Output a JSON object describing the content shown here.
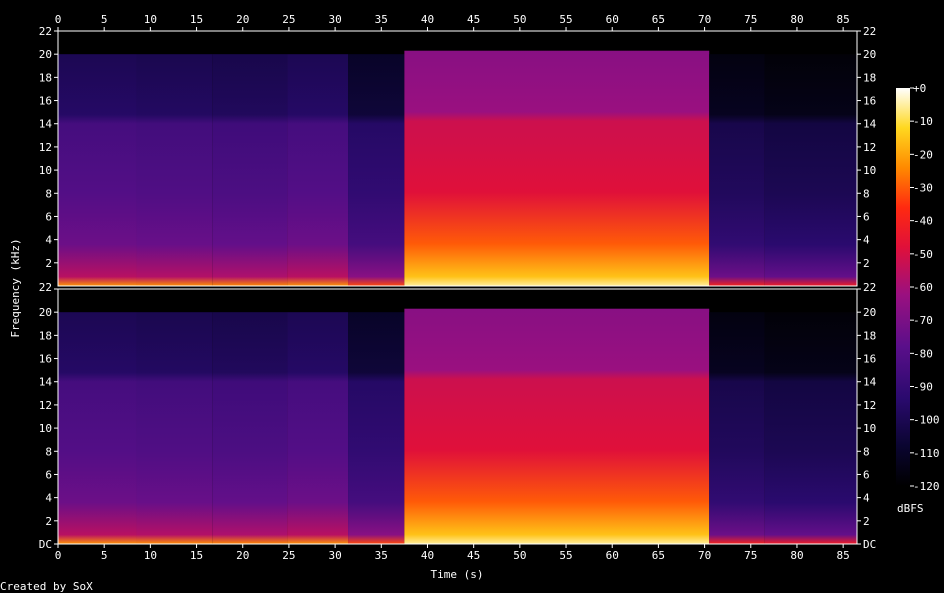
{
  "chart_data": {
    "type": "heatmap",
    "title": "",
    "xlabel": "Time (s)",
    "ylabel": "Frequency (kHz)",
    "xlim": [
      0,
      86.5
    ],
    "ylim": [
      0,
      22
    ],
    "x_ticks": [
      0,
      5,
      10,
      15,
      20,
      25,
      30,
      35,
      40,
      45,
      50,
      55,
      60,
      65,
      70,
      75,
      80,
      85
    ],
    "y_ticks": [
      "DC",
      "2",
      "4",
      "6",
      "8",
      "10",
      "12",
      "14",
      "16",
      "18",
      "20",
      "22"
    ],
    "channels": 2,
    "colorbar": {
      "label": "dBFS",
      "ticks": [
        "+0",
        "-10",
        "-20",
        "-30",
        "-40",
        "-50",
        "-60",
        "-70",
        "-80",
        "-90",
        "-100",
        "-110",
        "-120"
      ],
      "range": [
        -120,
        0
      ]
    },
    "segments": [
      {
        "start": 0,
        "end": 8.5,
        "level": -82,
        "max_khz": 20
      },
      {
        "start": 8.5,
        "end": 16.7,
        "level": -83,
        "max_khz": 20
      },
      {
        "start": 16.7,
        "end": 24.8,
        "level": -84,
        "max_khz": 20
      },
      {
        "start": 24.8,
        "end": 31.4,
        "level": -82,
        "max_khz": 20
      },
      {
        "start": 31.4,
        "end": 37.5,
        "level": -92,
        "max_khz": 20
      },
      {
        "start": 37.5,
        "end": 70.5,
        "level": -52,
        "max_khz": 20.3
      },
      {
        "start": 70.5,
        "end": 76.5,
        "level": -98,
        "max_khz": 20
      },
      {
        "start": 76.5,
        "end": 86.5,
        "level": -100,
        "max_khz": 20
      }
    ],
    "footer": "Created by SoX"
  }
}
